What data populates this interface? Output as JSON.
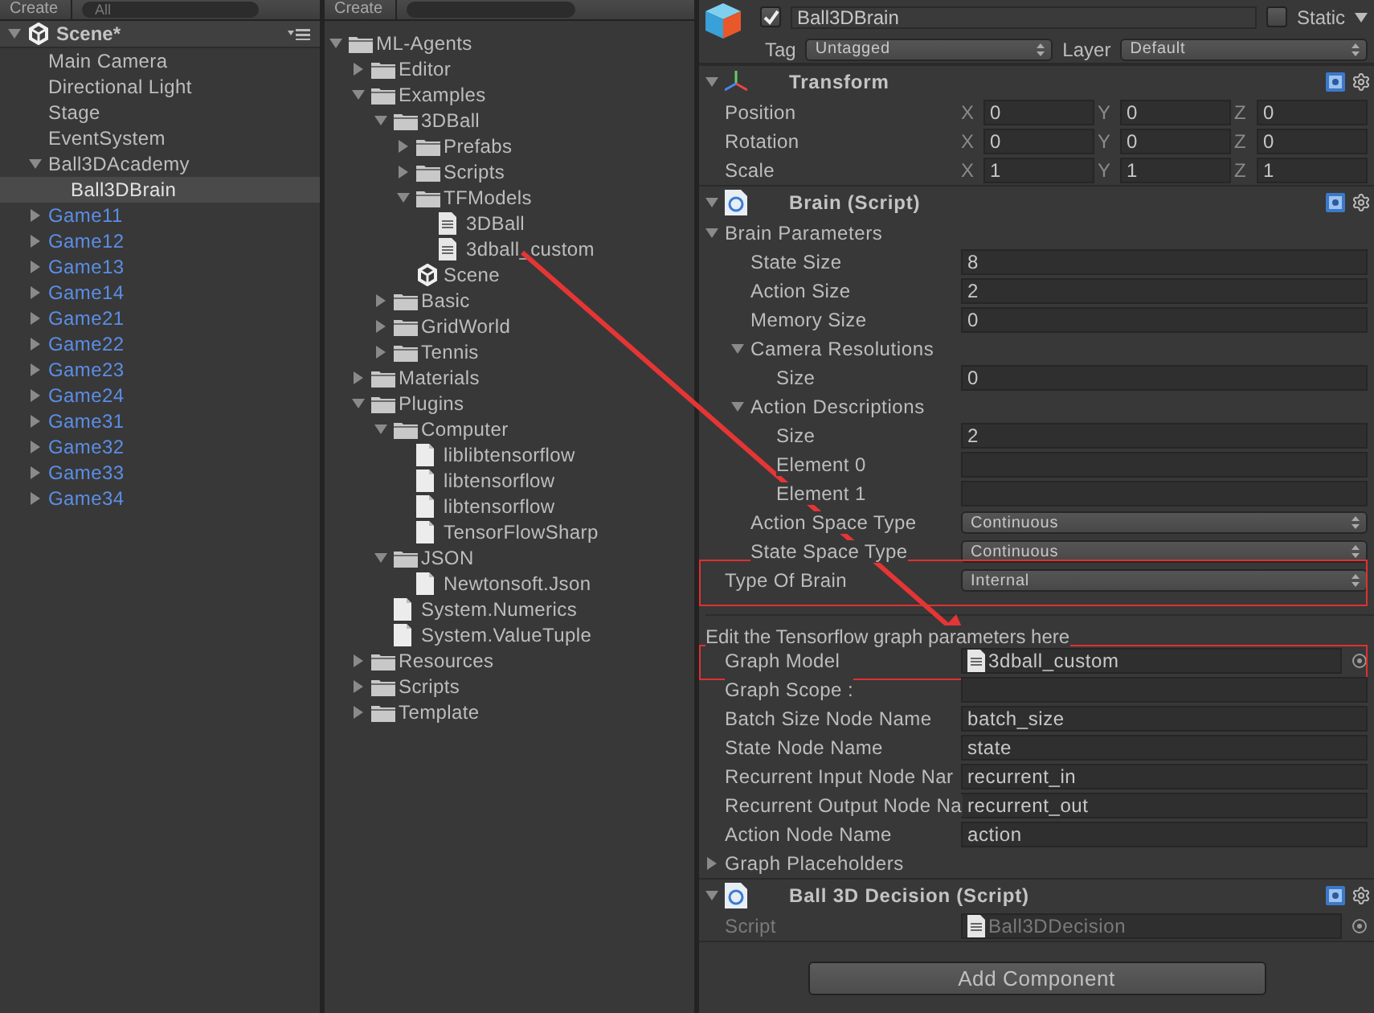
{
  "hierarchy": {
    "toolbar": {
      "create": "Create",
      "search_placeholder": "All"
    },
    "scene": {
      "name": "Scene*",
      "expanded": true
    },
    "items": [
      {
        "name": "Main Camera",
        "prefab": false,
        "selected": false
      },
      {
        "name": "Directional Light",
        "prefab": false,
        "selected": false
      },
      {
        "name": "Stage",
        "prefab": false,
        "selected": false
      },
      {
        "name": "EventSystem",
        "prefab": false,
        "selected": false
      },
      {
        "name": "Ball3DAcademy",
        "prefab": false,
        "selected": false,
        "expanded": true,
        "children": [
          {
            "name": "Ball3DBrain",
            "prefab": false,
            "selected": true
          }
        ]
      },
      {
        "name": "Game11",
        "prefab": true,
        "selected": false,
        "expanded": false
      },
      {
        "name": "Game12",
        "prefab": true,
        "selected": false,
        "expanded": false
      },
      {
        "name": "Game13",
        "prefab": true,
        "selected": false,
        "expanded": false
      },
      {
        "name": "Game14",
        "prefab": true,
        "selected": false,
        "expanded": false
      },
      {
        "name": "Game21",
        "prefab": true,
        "selected": false,
        "expanded": false
      },
      {
        "name": "Game22",
        "prefab": true,
        "selected": false,
        "expanded": false
      },
      {
        "name": "Game23",
        "prefab": true,
        "selected": false,
        "expanded": false
      },
      {
        "name": "Game24",
        "prefab": true,
        "selected": false,
        "expanded": false
      },
      {
        "name": "Game31",
        "prefab": true,
        "selected": false,
        "expanded": false
      },
      {
        "name": "Game32",
        "prefab": true,
        "selected": false,
        "expanded": false
      },
      {
        "name": "Game33",
        "prefab": true,
        "selected": false,
        "expanded": false
      },
      {
        "name": "Game34",
        "prefab": true,
        "selected": false,
        "expanded": false
      }
    ]
  },
  "project": {
    "toolbar": {
      "create": "Create"
    },
    "items": [
      {
        "name": "ML-Agents",
        "kind": "folder",
        "expanded": true,
        "children": [
          {
            "name": "Editor",
            "kind": "folder",
            "expanded": false
          },
          {
            "name": "Examples",
            "kind": "folder",
            "expanded": true,
            "children": [
              {
                "name": "3DBall",
                "kind": "folder",
                "expanded": true,
                "children": [
                  {
                    "name": "Prefabs",
                    "kind": "folder",
                    "expanded": false
                  },
                  {
                    "name": "Scripts",
                    "kind": "folder",
                    "expanded": false
                  },
                  {
                    "name": "TFModels",
                    "kind": "folder",
                    "expanded": true,
                    "children": [
                      {
                        "name": "3DBall",
                        "kind": "asset"
                      },
                      {
                        "name": "3dball_custom",
                        "kind": "asset"
                      }
                    ]
                  },
                  {
                    "name": "Scene",
                    "kind": "scene"
                  }
                ]
              },
              {
                "name": "Basic",
                "kind": "folder",
                "expanded": false
              },
              {
                "name": "GridWorld",
                "kind": "folder",
                "expanded": false
              },
              {
                "name": "Tennis",
                "kind": "folder",
                "expanded": false
              }
            ]
          },
          {
            "name": "Materials",
            "kind": "folder",
            "expanded": false
          },
          {
            "name": "Plugins",
            "kind": "folder",
            "expanded": true,
            "children": [
              {
                "name": "Computer",
                "kind": "folder",
                "expanded": true,
                "children": [
                  {
                    "name": "liblibtensorflow",
                    "kind": "file"
                  },
                  {
                    "name": "libtensorflow",
                    "kind": "file"
                  },
                  {
                    "name": "libtensorflow",
                    "kind": "file"
                  },
                  {
                    "name": "TensorFlowSharp",
                    "kind": "file"
                  }
                ]
              },
              {
                "name": "JSON",
                "kind": "folder",
                "expanded": true,
                "children": [
                  {
                    "name": "Newtonsoft.Json",
                    "kind": "file"
                  }
                ]
              },
              {
                "name": "System.Numerics",
                "kind": "file"
              },
              {
                "name": "System.ValueTuple",
                "kind": "file"
              }
            ]
          },
          {
            "name": "Resources",
            "kind": "folder",
            "expanded": false
          },
          {
            "name": "Scripts",
            "kind": "folder",
            "expanded": false
          },
          {
            "name": "Template",
            "kind": "folder",
            "expanded": false
          }
        ]
      }
    ]
  },
  "inspector": {
    "object": {
      "active": true,
      "name": "Ball3DBrain",
      "static": false,
      "static_label": "Static",
      "tag_label": "Tag",
      "tag": "Untagged",
      "layer_label": "Layer",
      "layer": "Default"
    },
    "components": [
      {
        "kind": "transform",
        "title": "Transform",
        "expanded": true,
        "rows": [
          {
            "label": "Position",
            "axes": [
              "X",
              "Y",
              "Z"
            ],
            "values": [
              "0",
              "0",
              "0"
            ]
          },
          {
            "label": "Rotation",
            "axes": [
              "X",
              "Y",
              "Z"
            ],
            "values": [
              "0",
              "0",
              "0"
            ]
          },
          {
            "label": "Scale",
            "axes": [
              "X",
              "Y",
              "Z"
            ],
            "values": [
              "1",
              "1",
              "1"
            ]
          }
        ]
      },
      {
        "kind": "script",
        "title": "Brain (Script)",
        "expanded": true,
        "properties": [
          {
            "kind": "foldout",
            "label": "Brain Parameters",
            "expanded": true,
            "children": [
              {
                "kind": "field",
                "label": "State Size",
                "value": "8"
              },
              {
                "kind": "field",
                "label": "Action Size",
                "value": "2"
              },
              {
                "kind": "field",
                "label": "Memory Size",
                "value": "0"
              },
              {
                "kind": "foldout",
                "label": "Camera Resolutions",
                "expanded": true,
                "children": [
                  {
                    "kind": "field",
                    "label": "Size",
                    "value": "0"
                  }
                ]
              },
              {
                "kind": "foldout",
                "label": "Action Descriptions",
                "expanded": true,
                "children": [
                  {
                    "kind": "field",
                    "label": "Size",
                    "value": "2"
                  },
                  {
                    "kind": "field",
                    "label": "Element 0"
                  },
                  {
                    "kind": "field",
                    "label": "Element 1"
                  }
                ]
              },
              {
                "kind": "dropdown",
                "label": "Action Space Type",
                "value": "Continuous"
              },
              {
                "kind": "dropdown",
                "label": "State Space Type",
                "value": "Continuous"
              }
            ]
          },
          {
            "kind": "dropdown",
            "label": "Type Of Brain",
            "value": "Internal",
            "highlighted": true
          },
          {
            "kind": "note",
            "text": "Edit the Tensorflow graph parameters here"
          },
          {
            "kind": "object",
            "label": "Graph Model",
            "value": "3dball_custom",
            "highlighted": true
          },
          {
            "kind": "field",
            "label": "Graph Scope :"
          },
          {
            "kind": "field",
            "label": "Batch Size Node Name",
            "value": "batch_size"
          },
          {
            "kind": "field",
            "label": "State Node Name",
            "value": "state"
          },
          {
            "kind": "field",
            "label": "Recurrent Input Node Nar",
            "value": "recurrent_in"
          },
          {
            "kind": "field",
            "label": "Recurrent Output Node Na",
            "value": "recurrent_out"
          },
          {
            "kind": "field",
            "label": "Action Node Name",
            "value": "action"
          },
          {
            "kind": "foldout",
            "label": "Graph Placeholders",
            "expanded": false
          }
        ]
      },
      {
        "kind": "script",
        "title": "Ball 3D Decision (Script)",
        "expanded": true,
        "properties": [
          {
            "kind": "object",
            "label": "Script",
            "value": "Ball3DDecision",
            "disabled": true
          }
        ]
      }
    ],
    "add_component": "Add Component"
  },
  "annotation": {
    "arrow": true
  }
}
